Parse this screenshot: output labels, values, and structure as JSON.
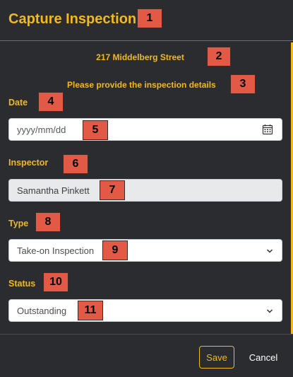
{
  "header": {
    "title": "Capture Inspection"
  },
  "form": {
    "address": "217 Middelberg Street",
    "instructions": "Please provide the inspection details",
    "date": {
      "label": "Date",
      "placeholder": "yyyy/mm/dd",
      "icon": "calendar-icon"
    },
    "inspector": {
      "label": "Inspector",
      "value": "Samantha Pinkett"
    },
    "type": {
      "label": "Type",
      "value": "Take-on Inspection"
    },
    "status": {
      "label": "Status",
      "value": "Outstanding"
    }
  },
  "footer": {
    "save_label": "Save",
    "cancel_label": "Cancel"
  },
  "callouts": [
    "1",
    "2",
    "3",
    "4",
    "5",
    "6",
    "7",
    "8",
    "9",
    "10",
    "11"
  ],
  "colors": {
    "accent": "#f3b919",
    "background": "#2b2c2f",
    "callout": "#e25a45"
  }
}
